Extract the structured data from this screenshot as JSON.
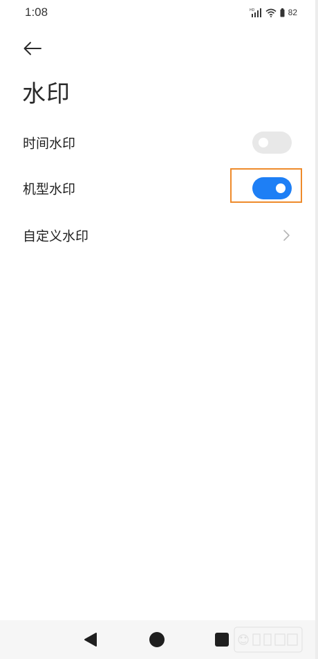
{
  "status_bar": {
    "time": "1:08",
    "battery": "82",
    "network_badge": "HD"
  },
  "page": {
    "title": "水印"
  },
  "settings": {
    "time_watermark": {
      "label": "时间水印",
      "enabled": false
    },
    "model_watermark": {
      "label": "机型水印",
      "enabled": true
    },
    "custom_watermark": {
      "label": "自定义水印"
    }
  },
  "colors": {
    "toggle_on": "#1e7ff5",
    "toggle_off": "#e8e8e8",
    "highlight": "#ee8a2a"
  },
  "icons": {
    "back": "arrow-left-icon",
    "chevron": "chevron-right-icon",
    "nav_back": "triangle-back-icon",
    "nav_home": "circle-home-icon",
    "nav_recents": "square-recents-icon"
  }
}
